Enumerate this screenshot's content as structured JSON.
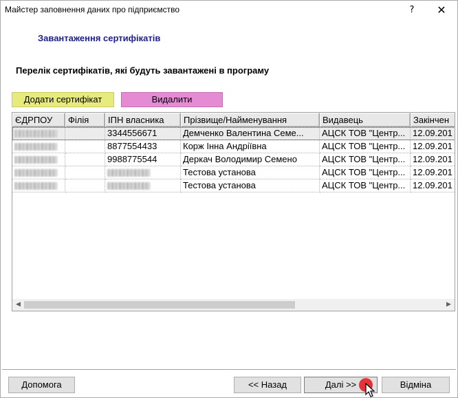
{
  "window": {
    "title": "Майстер заповнення даних про підприємство",
    "help_glyph": "?",
    "close_glyph": "✕"
  },
  "wizard": {
    "step_title": "Завантаження сертифікатів",
    "list_heading": "Перелік сертифікатів, які будуть завантажені в програму"
  },
  "actions": {
    "add_label": "Додати сертифікат",
    "delete_label": "Видалити",
    "add_color": "#e7ea7c",
    "delete_color": "#e48bd4"
  },
  "table": {
    "columns": [
      "ЄДРПОУ",
      "Філія",
      "ІПН власника",
      "Прізвище/Найменування",
      "Видавець",
      "Закінчен"
    ],
    "rows": [
      {
        "edrpou": "",
        "filia": "",
        "ipn": "3344556671",
        "name": "Демченко Валентина Семе...",
        "issuer": "АЦСК ТОВ \"Центр...",
        "expires": "12.09.201"
      },
      {
        "edrpou": "",
        "filia": "",
        "ipn": "8877554433",
        "name": "Корж Інна Андріївна",
        "issuer": "АЦСК ТОВ \"Центр...",
        "expires": "12.09.201"
      },
      {
        "edrpou": "",
        "filia": "",
        "ipn": "9988775544",
        "name": "Деркач Володимир Семено",
        "issuer": "АЦСК ТОВ \"Центр...",
        "expires": "12.09.201"
      },
      {
        "edrpou": "",
        "filia": "",
        "ipn": "",
        "name": "Тестова установа",
        "issuer": "АЦСК ТОВ \"Центр...",
        "expires": "12.09.201"
      },
      {
        "edrpou": "",
        "filia": "",
        "ipn": "",
        "name": "Тестова установа",
        "issuer": "АЦСК ТОВ \"Центр...",
        "expires": "12.09.201"
      }
    ],
    "selected_row": 0
  },
  "footer": {
    "help_label": "Допомога",
    "back_label": "<< Назад",
    "next_label": "Далі >>",
    "cancel_label": "Відміна"
  },
  "icons": {
    "scroll_left": "◀",
    "scroll_right": "▶"
  }
}
